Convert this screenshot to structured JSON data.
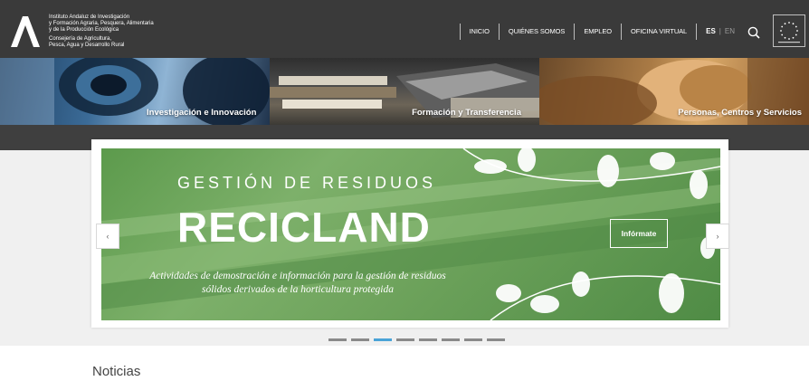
{
  "header": {
    "org_lines": [
      "Instituto Andaluz de Investigación",
      "y Formación Agraria, Pesquera, Alimentaria",
      "y de la Producción Ecológica"
    ],
    "ministry_lines": [
      "Consejería de Agricultura,",
      "Pesca, Agua y Desarrollo Rural"
    ],
    "nav": [
      "INICIO",
      "QUIÉNES SOMOS",
      "EMPLEO",
      "OFICINA VIRTUAL"
    ],
    "lang": {
      "active": "ES",
      "separator": "|",
      "inactive": "EN"
    },
    "search_icon": "search-icon",
    "colors": {
      "bar": "#3a3a3a"
    }
  },
  "categories": [
    {
      "label": "Investigación e Innovación"
    },
    {
      "label": "Formación y Transferencia"
    },
    {
      "label": "Personas, Centros y Servicios"
    }
  ],
  "slider": {
    "eyebrow": "GESTIÓN DE RESIDUOS",
    "title": "RECICLAND",
    "description": "Actividades de demostración e información para la gestión de residuos sólidos derivados de la horticultura protegida",
    "cta": "Infórmate",
    "prev_label": "‹",
    "next_label": "›",
    "dots_count": 8,
    "active_dot": 3,
    "colors": {
      "accent": "#4aa3d7",
      "slide_green": "#6ea35c"
    }
  },
  "news": {
    "title": "Noticias"
  }
}
